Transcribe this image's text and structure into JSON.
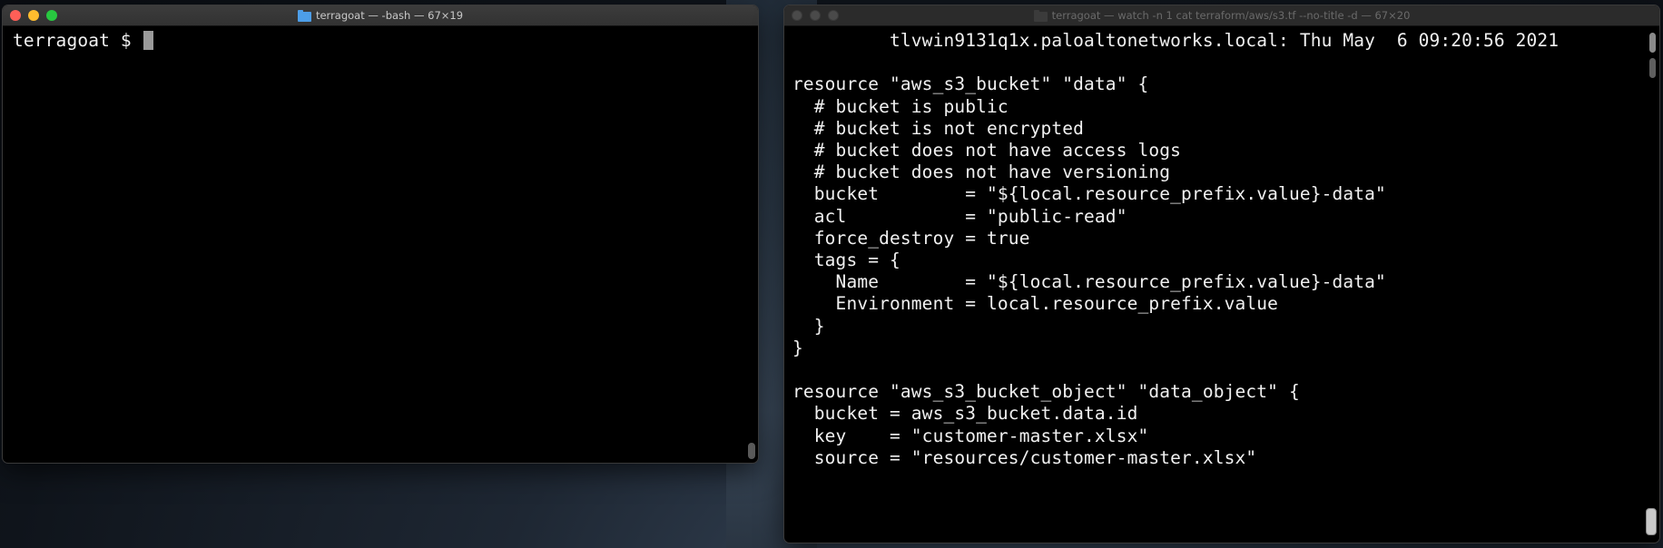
{
  "left_window": {
    "title": "terragoat — -bash — 67×19",
    "prompt": "terragoat $"
  },
  "right_window": {
    "title": "terragoat — watch -n 1 cat terraform/aws/s3.tf --no-title -d — 67×20",
    "lines": [
      "         tlvwin9131q1x.paloaltonetworks.local: Thu May  6 09:20:56 2021",
      "",
      "resource \"aws_s3_bucket\" \"data\" {",
      "  # bucket is public",
      "  # bucket is not encrypted",
      "  # bucket does not have access logs",
      "  # bucket does not have versioning",
      "  bucket        = \"${local.resource_prefix.value}-data\"",
      "  acl           = \"public-read\"",
      "  force_destroy = true",
      "  tags = {",
      "    Name        = \"${local.resource_prefix.value}-data\"",
      "    Environment = local.resource_prefix.value",
      "  }",
      "}",
      "",
      "resource \"aws_s3_bucket_object\" \"data_object\" {",
      "  bucket = aws_s3_bucket.data.id",
      "  key    = \"customer-master.xlsx\"",
      "  source = \"resources/customer-master.xlsx\""
    ]
  }
}
